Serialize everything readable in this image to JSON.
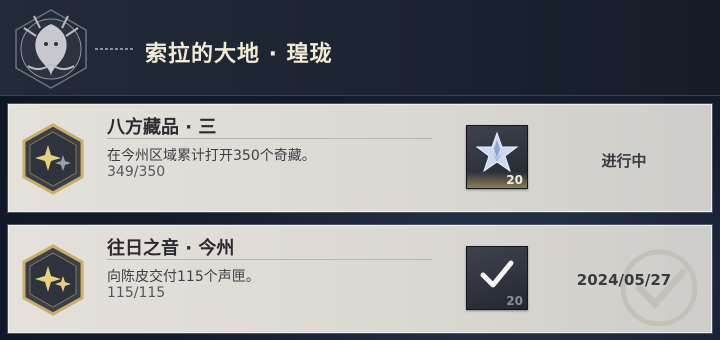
{
  "header": {
    "title": "索拉的大地 · 瑝珑"
  },
  "achievements": [
    {
      "title": "八方藏品 · 三",
      "description": "在今州区域累计打开350个奇藏。",
      "progress": "349/350",
      "reward_icon": "crystal-star-icon",
      "reward_qty": "20",
      "status": "进行中"
    },
    {
      "title": "往日之音 · 今州",
      "description": "向陈皮交付115个声匣。",
      "progress": "115/115",
      "reward_icon": "checkmark-icon",
      "reward_qty": "20",
      "status": "2024/05/27"
    }
  ],
  "colors": {
    "header_bg": "#1b2230",
    "card_bg": "#dcd9d3",
    "badge_gold": "#e8cf82",
    "title_text": "#f1ead5"
  }
}
